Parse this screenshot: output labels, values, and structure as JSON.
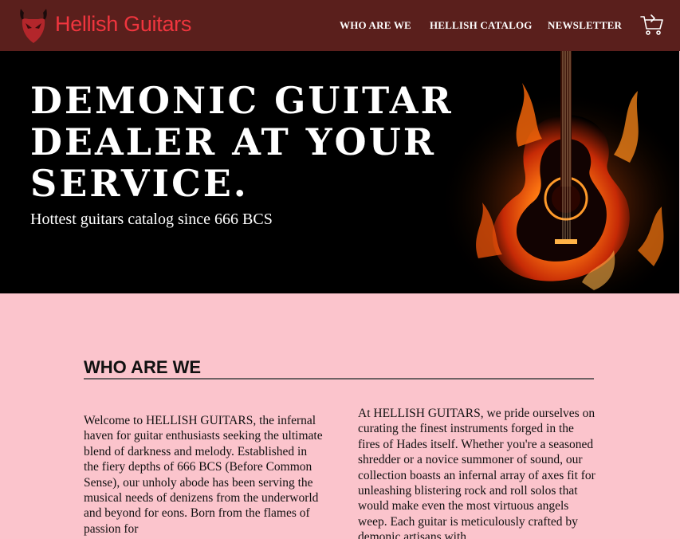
{
  "brand": {
    "name": "Hellish Guitars",
    "color": "#f0353e"
  },
  "nav": {
    "links": [
      "WHO ARE WE",
      "HELLISH CATALOG",
      "NEWSLETTER"
    ],
    "cart_icon": "shopping-cart-icon",
    "background": "#5a1f1c"
  },
  "hero": {
    "title": "DEMONIC GUITAR DEALER AT YOUR SERVICE.",
    "subtitle": "Hottest guitars catalog since 666 BCS",
    "art": "flaming-guitar-image"
  },
  "about": {
    "heading": "WHO ARE WE",
    "left_text": "Welcome to HELLISH GUITARS, the infernal haven for guitar enthusiasts seeking the ultimate blend of darkness and melody. Established in the fiery depths of 666 BCS (Before Common Sense), our unholy abode has been serving the musical needs of denizens from the underworld and beyond for eons. Born from the flames of passion for",
    "right_text": "At HELLISH GUITARS, we pride ourselves on curating the finest instruments forged in the fires of Hades itself. Whether you're a seasoned shredder or a novice summoner of sound, our collection boasts an infernal array of axes fit for unleashing blistering rock and roll solos that would make even the most virtuous angels weep. Each guitar is meticulously crafted by demonic artisans with"
  },
  "colors": {
    "page_bg": "#fbc4cc",
    "hero_bg": "#000000"
  }
}
